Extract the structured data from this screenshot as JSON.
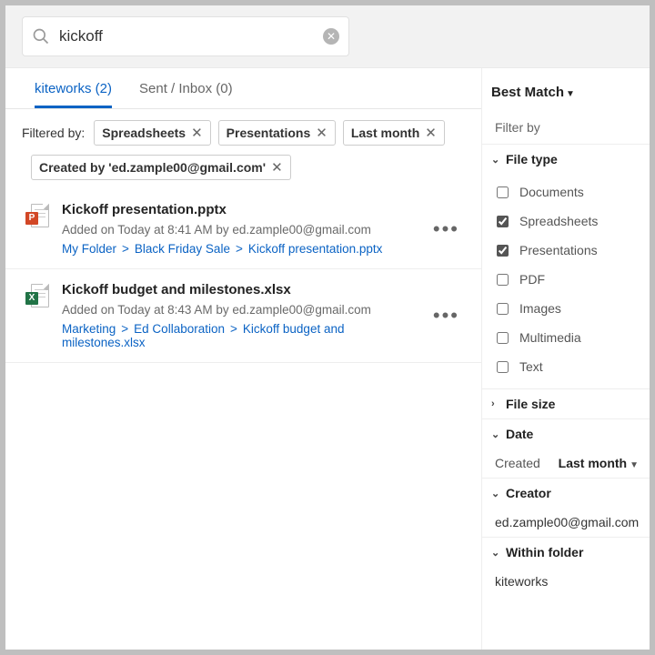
{
  "search": {
    "value": "kickoff"
  },
  "tabs": [
    {
      "label": "kiteworks (2)",
      "active": true
    },
    {
      "label": "Sent / Inbox (0)",
      "active": false
    }
  ],
  "filters_label": "Filtered by:",
  "chips_row1": [
    {
      "label": "Spreadsheets"
    },
    {
      "label": "Presentations"
    },
    {
      "label": "Last month"
    }
  ],
  "chips_row2": [
    {
      "label": "Created by 'ed.zample00@gmail.com'"
    }
  ],
  "results": [
    {
      "title": "Kickoff presentation.pptx",
      "meta": "Added on Today at 8:41 AM by ed.zample00@gmail.com",
      "path": [
        "My Folder",
        "Black Friday Sale",
        "Kickoff presentation.pptx"
      ],
      "icon": "ppt"
    },
    {
      "title": "Kickoff budget and milestones.xlsx",
      "meta": "Added on Today at 8:43 AM by ed.zample00@gmail.com",
      "path": [
        "Marketing",
        "Ed Collaboration",
        "Kickoff budget and milestones.xlsx"
      ],
      "icon": "xls"
    }
  ],
  "sort": {
    "label": "Best Match"
  },
  "filter_panel": {
    "title": "Filter by",
    "file_type": {
      "label": "File type",
      "items": [
        {
          "label": "Documents",
          "checked": false
        },
        {
          "label": "Spreadsheets",
          "checked": true
        },
        {
          "label": "Presentations",
          "checked": true
        },
        {
          "label": "PDF",
          "checked": false
        },
        {
          "label": "Images",
          "checked": false
        },
        {
          "label": "Multimedia",
          "checked": false
        },
        {
          "label": "Text",
          "checked": false
        }
      ]
    },
    "file_size": {
      "label": "File size"
    },
    "date": {
      "label": "Date",
      "field": "Created",
      "value": "Last month"
    },
    "creator": {
      "label": "Creator",
      "value": "ed.zample00@gmail.com"
    },
    "within_folder": {
      "label": "Within folder",
      "value": "kiteworks"
    }
  }
}
